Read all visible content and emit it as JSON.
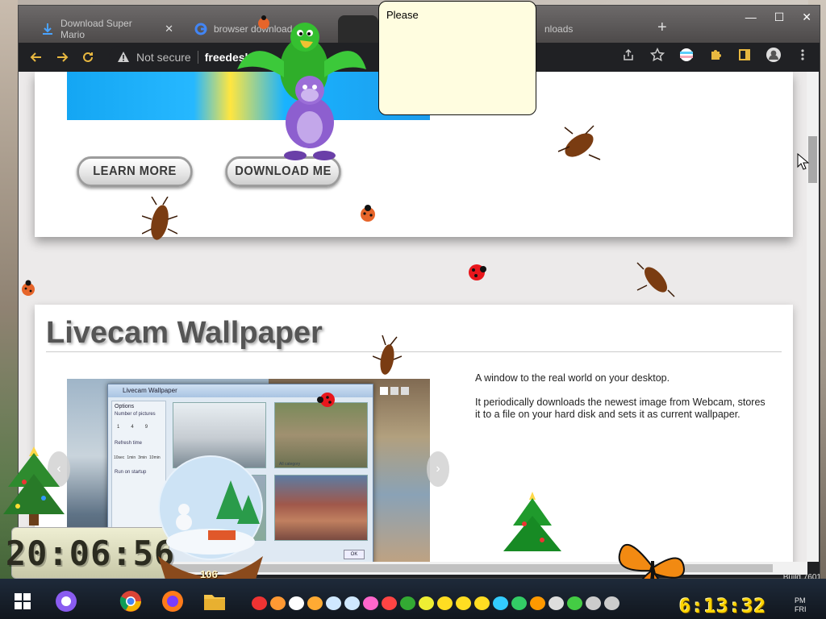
{
  "browser": {
    "tabs": [
      {
        "title": "Download Super Mario",
        "active": false
      },
      {
        "title": "browser download",
        "active": false
      },
      {
        "title": "",
        "active": true
      },
      {
        "title": "nloads",
        "active": false
      }
    ],
    "window_controls": [
      "—",
      "☐",
      "✕"
    ],
    "address": {
      "security_label": "Not secure",
      "url": "freedesk"
    }
  },
  "page": {
    "buttons": {
      "learn_more": "LEARN MORE",
      "download_me": "DOWNLOAD ME"
    },
    "section": {
      "title": "Livecam Wallpaper",
      "description": [
        "A window to the real world on your desktop.",
        "It periodically downloads the newest image from Webcam, stores it to a file on your hard disk and sets it as current wallpaper."
      ]
    },
    "app_window": {
      "title": "Livecam Wallpaper",
      "options_label": "Options",
      "number_of_pictures": "Number of pictures",
      "num_options": [
        "1",
        "4",
        "9"
      ],
      "refresh_time": "Refresh time",
      "refresh_options": [
        "10sec",
        "1min",
        "3min",
        "10min"
      ],
      "run_on_startup": "Run on startup",
      "thumb_label": "All category",
      "ok_label": "OK"
    }
  },
  "overlay": {
    "speech_bubble": "Please",
    "desktop_clock": "20:06:56",
    "snow_globe_counter": "106",
    "build_label": "Build 7601"
  },
  "taskbar": {
    "clock": "6:13:32",
    "ampm": "PM",
    "day": "FRI"
  },
  "colors": {
    "accent_blue": "#14a6f3",
    "tab_bar": "#5a5757",
    "clock_yellow": "#ffd400"
  }
}
